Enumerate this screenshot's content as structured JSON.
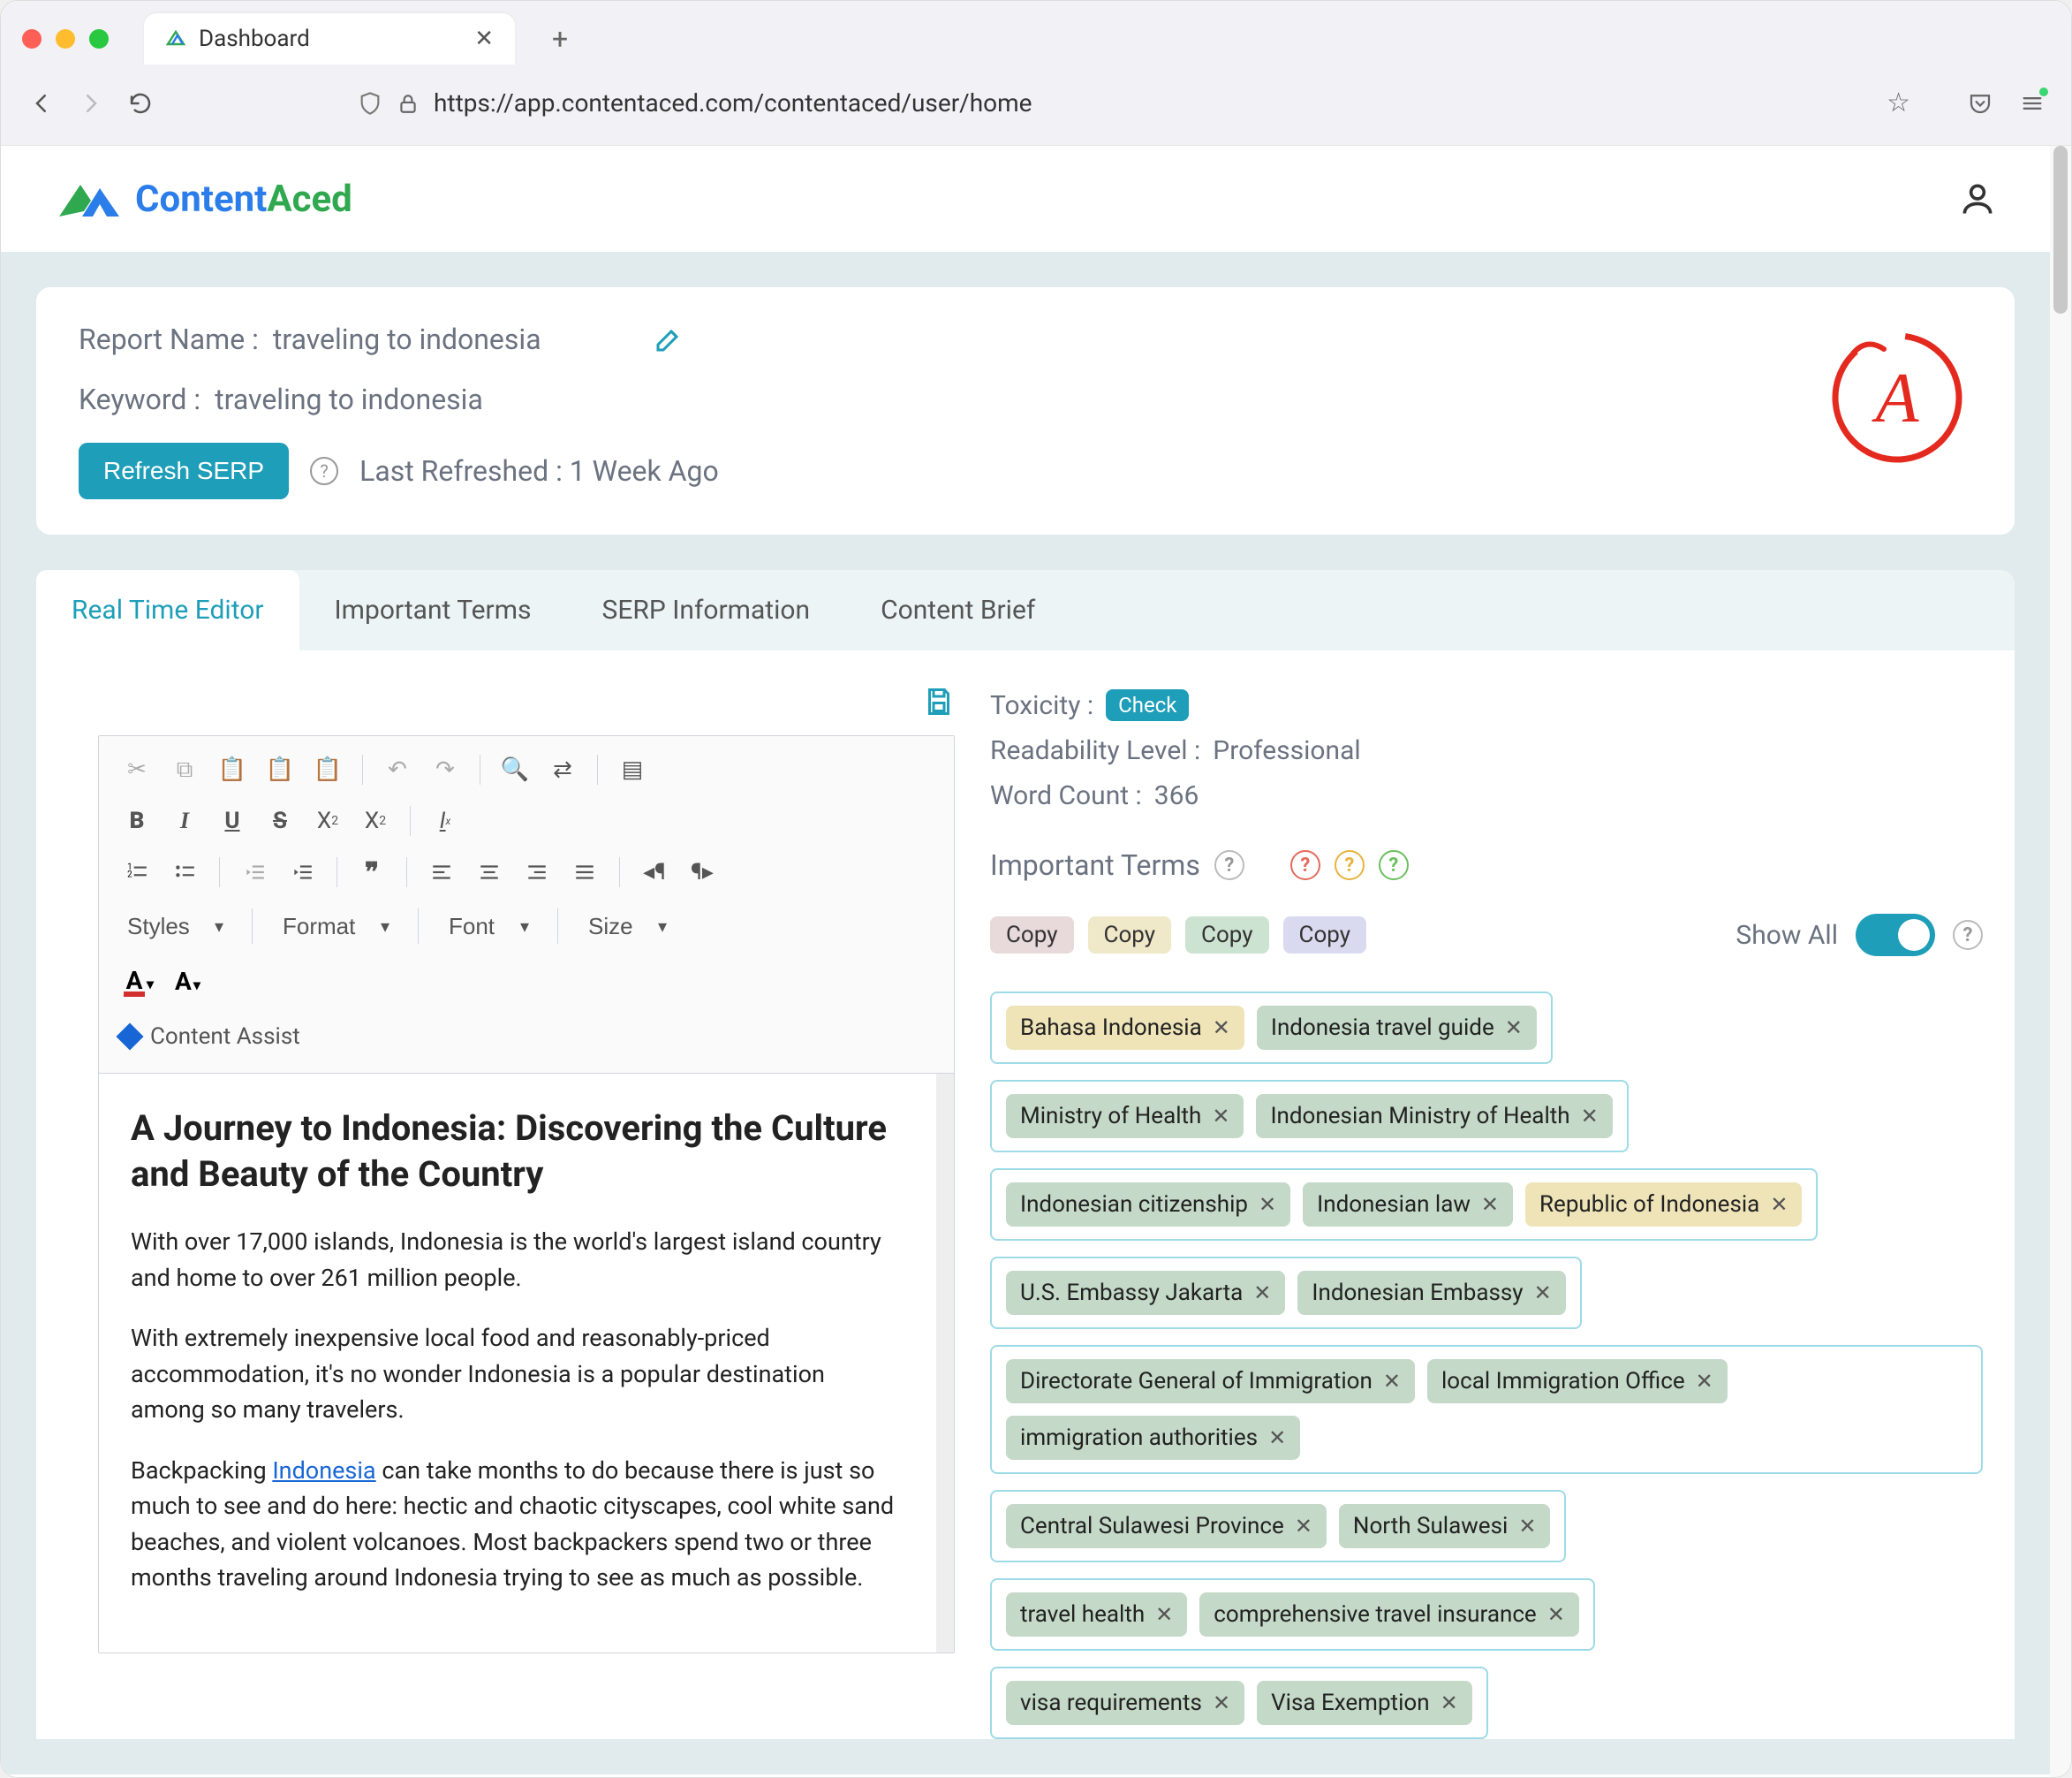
{
  "browser": {
    "tab_title": "Dashboard",
    "url": "https://app.contentaced.com/contentaced/user/home"
  },
  "brand": {
    "name1": "Content",
    "name2": "Aced"
  },
  "report": {
    "name_label": "Report Name :",
    "name_value": "traveling to indonesia",
    "keyword_label": "Keyword :",
    "keyword_value": "traveling to indonesia",
    "refresh_btn": "Refresh SERP",
    "last_refreshed_label": "Last Refreshed :",
    "last_refreshed_value": "1 Week Ago",
    "grade": "A"
  },
  "tabs": {
    "items": [
      "Real Time Editor",
      "Important Terms",
      "SERP Information",
      "Content Brief"
    ]
  },
  "toolbar": {
    "styles": "Styles",
    "format": "Format",
    "font": "Font",
    "size": "Size",
    "content_assist": "Content Assist"
  },
  "article": {
    "title": "A Journey to Indonesia: Discovering the Culture and Beauty of the Country",
    "p1": "With over 17,000 islands, Indonesia is the world's largest island country and home to over 261 million people.",
    "p2": "With extremely inexpensive local food and reasonably-priced accommodation, it's no wonder Indonesia is a popular destination among so many travelers.",
    "p3a": "Backpacking ",
    "p3link": "Indonesia",
    "p3b": " can take months to do because there is just so much to see and do here: hectic and chaotic cityscapes, cool white sand beaches, and violent volcanoes. Most backpackers spend two or three months traveling around Indonesia trying to see as much as possible."
  },
  "meta": {
    "toxicity_label": "Toxicity :",
    "toxicity_btn": "Check",
    "readability_label": "Readability Level :",
    "readability_value": "Professional",
    "wordcount_label": "Word Count :",
    "wordcount_value": "366",
    "important_terms_label": "Important Terms",
    "copy_label": "Copy",
    "showall_label": "Show All"
  },
  "term_groups": [
    [
      {
        "text": "Bahasa Indonesia",
        "color": "yellow"
      },
      {
        "text": "Indonesia travel guide",
        "color": "green"
      }
    ],
    [
      {
        "text": "Ministry of Health",
        "color": "green"
      },
      {
        "text": "Indonesian Ministry of Health",
        "color": "green"
      }
    ],
    [
      {
        "text": "Indonesian citizenship",
        "color": "green"
      },
      {
        "text": "Indonesian law",
        "color": "green"
      },
      {
        "text": "Republic of Indonesia",
        "color": "yellow"
      }
    ],
    [
      {
        "text": "U.S. Embassy Jakarta",
        "color": "green"
      },
      {
        "text": "Indonesian Embassy",
        "color": "green"
      }
    ],
    [
      {
        "text": "Directorate General of Immigration",
        "color": "green"
      },
      {
        "text": "local Immigration Office",
        "color": "green"
      },
      {
        "text": "immigration authorities",
        "color": "green"
      }
    ],
    [
      {
        "text": "Central Sulawesi Province",
        "color": "green"
      },
      {
        "text": "North Sulawesi",
        "color": "green"
      }
    ],
    [
      {
        "text": "travel health",
        "color": "green"
      },
      {
        "text": "comprehensive travel insurance",
        "color": "green"
      }
    ],
    [
      {
        "text": "visa requirements",
        "color": "green"
      },
      {
        "text": "Visa Exemption",
        "color": "green"
      }
    ]
  ]
}
